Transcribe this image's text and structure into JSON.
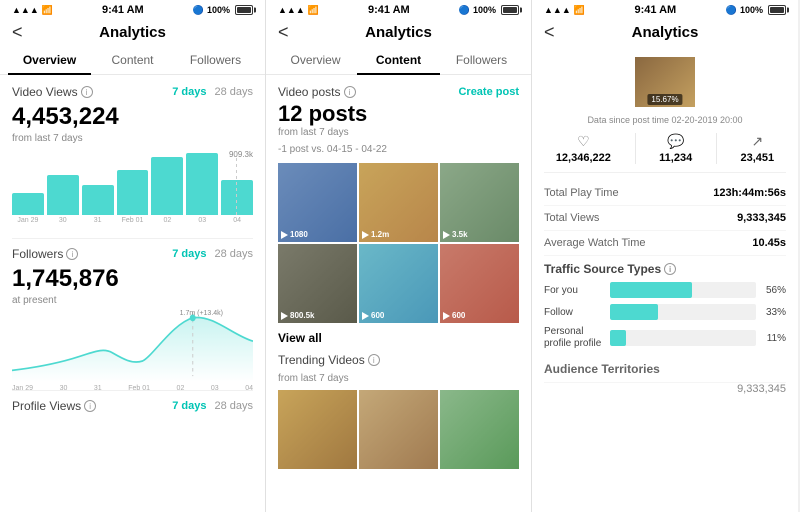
{
  "panels": [
    {
      "id": "overview",
      "status": {
        "time": "9:41 AM",
        "signal": "▲▲▲",
        "bluetooth": "🔵",
        "battery": "100%"
      },
      "nav": {
        "back": "<",
        "title": "Analytics"
      },
      "tabs": [
        {
          "label": "Overview",
          "active": true
        },
        {
          "label": "Content",
          "active": false
        },
        {
          "label": "Followers",
          "active": false
        }
      ],
      "video_views": {
        "label": "Video Views",
        "value": "4,453,224",
        "sub": "from last 7 days",
        "filters": [
          "7 days",
          "28 days"
        ],
        "active_filter": "7 days",
        "peak": "909.3k",
        "bars": [
          25,
          55,
          40,
          60,
          100,
          110,
          45
        ],
        "bar_labels": [
          "Jan 29",
          "30",
          "31",
          "Feb 01",
          "02",
          "03",
          "04"
        ]
      },
      "followers": {
        "label": "Followers",
        "value": "1,745,876",
        "sub": "at present",
        "filters": [
          "7 days",
          "28 days"
        ],
        "active_filter": "7 days",
        "peak": "1.7m (+13.4k)"
      },
      "profile_views": {
        "label": "Profile Views",
        "filters": [
          "7 days",
          "28 days"
        ]
      }
    },
    {
      "id": "content",
      "status": {
        "time": "9:41 AM"
      },
      "nav": {
        "back": "<",
        "title": "Analytics"
      },
      "tabs": [
        {
          "label": "Overview",
          "active": false
        },
        {
          "label": "Content",
          "active": true
        },
        {
          "label": "Followers",
          "active": false
        }
      ],
      "video_posts": {
        "label": "Video posts",
        "count": "12 posts",
        "sub": "from last 7 days",
        "sub2": "-1 post vs. 04-15 - 04-22",
        "create_btn": "Create post"
      },
      "grid_items": [
        {
          "color": "grid-color-1",
          "stat": "▷1080"
        },
        {
          "color": "grid-color-2",
          "stat": "▷1.2m"
        },
        {
          "color": "grid-color-3",
          "stat": "▷3.5k"
        },
        {
          "color": "grid-color-4",
          "stat": "▷800.5k"
        },
        {
          "color": "grid-color-5",
          "stat": "▷600"
        },
        {
          "color": "grid-color-6",
          "stat": "▷600"
        }
      ],
      "view_all": "View all",
      "trending": {
        "label": "Trending Videos",
        "sub": "from last 7 days",
        "items": [
          {
            "color": "trend-color-1"
          },
          {
            "color": "trend-color-2"
          },
          {
            "color": "trend-color-3"
          }
        ]
      }
    },
    {
      "id": "detail",
      "status": {
        "time": "9:41 AM"
      },
      "nav": {
        "back": "<",
        "title": "Analytics"
      },
      "post_image": {
        "percentage": "15.67%"
      },
      "post_date": "Data since post time 02-20-2019 20:00",
      "stats": [
        {
          "icon": "♡",
          "value": "12,346,222"
        },
        {
          "icon": "💬",
          "value": "11,234"
        },
        {
          "icon": "↗",
          "value": "23,451"
        }
      ],
      "details": [
        {
          "label": "Total Play Time",
          "value": "123h:44m:56s"
        },
        {
          "label": "Total Views",
          "value": "9,333,345"
        },
        {
          "label": "Average Watch Time",
          "value": "10.45s"
        }
      ],
      "traffic": {
        "label": "Traffic Source Types",
        "items": [
          {
            "name": "For you",
            "pct": 56,
            "display": "56%"
          },
          {
            "name": "Follow",
            "pct": 33,
            "display": "33%"
          },
          {
            "name": "Personal profile\nprofile",
            "pct": 11,
            "display": "11%"
          }
        ]
      },
      "audience": {
        "label": "Audience Territories",
        "value": "9,333,345"
      }
    }
  ]
}
